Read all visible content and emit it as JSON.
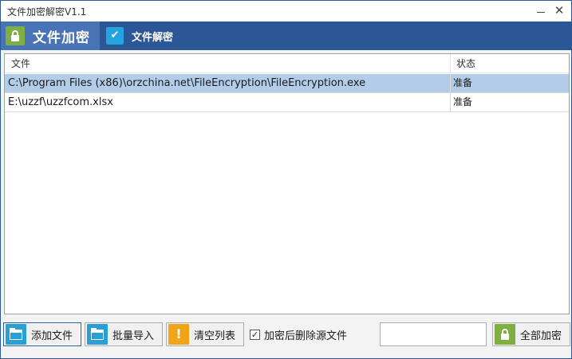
{
  "window": {
    "title": "文件加密解密V1.1",
    "minimize_glyph": "",
    "close_glyph": "✕"
  },
  "tabs": [
    {
      "label": "文件加密",
      "icon": "lock-icon",
      "active": true
    },
    {
      "label": "文件解密",
      "icon": "check-icon",
      "active": false
    }
  ],
  "list": {
    "columns": [
      "文件",
      "状态"
    ],
    "rows": [
      {
        "file": "C:\\Program Files (x86)\\orzchina.net\\FileEncryption\\FileEncryption.exe",
        "status": "准备",
        "selected": true
      },
      {
        "file": "E:\\uzzf\\uzzfcom.xlsx",
        "status": "准备",
        "selected": false
      }
    ]
  },
  "toolbar": {
    "add_file": "添加文件",
    "batch_import": "批量导入",
    "clear_list": "清空列表",
    "delete_after_encrypt": "加密后删除源文件",
    "delete_after_encrypt_checked": true,
    "text_value": "",
    "encrypt_all": "全部加密"
  },
  "colors": {
    "accent": "#2b5797",
    "active_tab": "#4873b4",
    "selection": "#b3cde8",
    "lock_green": "#7db040",
    "folder_blue": "#2a9fd6",
    "warning_orange": "#f0a418"
  }
}
